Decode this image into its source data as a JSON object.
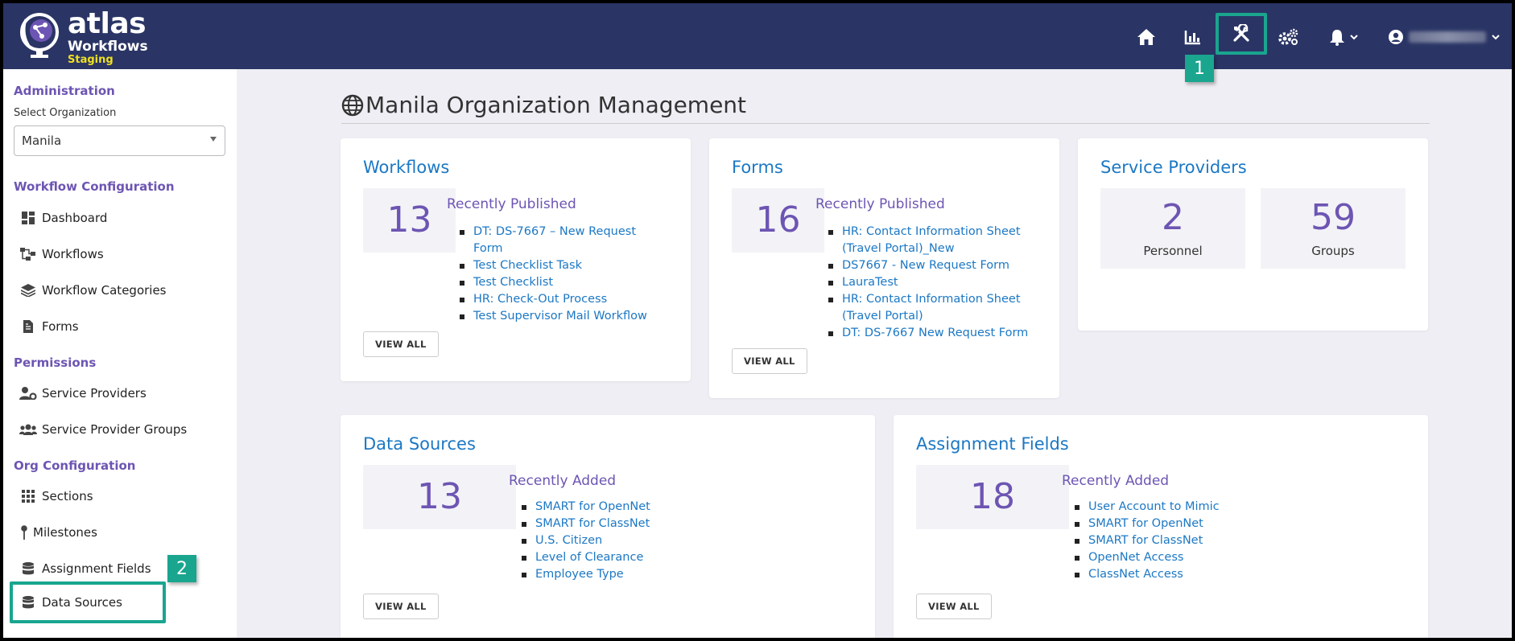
{
  "brand": {
    "name": "atlas",
    "product": "Workflows",
    "environment": "Staging"
  },
  "topnav": {
    "icons": [
      "home-icon",
      "bar-chart-icon",
      "tools-icon",
      "gears-icon",
      "bell-icon",
      "user-circle-icon"
    ],
    "callout_1": "1"
  },
  "sidebar": {
    "admin_heading": "Administration",
    "select_org_label": "Select Organization",
    "select_org_value": "Manila",
    "workflow_config_heading": "Workflow Configuration",
    "workflow_items": [
      "Dashboard",
      "Workflows",
      "Workflow Categories",
      "Forms"
    ],
    "permissions_heading": "Permissions",
    "permission_items": [
      "Service Providers",
      "Service Provider Groups"
    ],
    "org_config_heading": "Org Configuration",
    "org_items": [
      "Sections",
      "Milestones",
      "Assignment Fields",
      "Data Sources"
    ],
    "callout_2": "2"
  },
  "main": {
    "title": "Manila Organization Management",
    "workflows": {
      "title": "Workflows",
      "count": "13",
      "recent_heading": "Recently Published",
      "items": [
        "DT: DS-7667 – New Request Form",
        "Test Checklist Task",
        "Test Checklist",
        "HR: Check-Out Process",
        "Test Supervisor Mail Workflow"
      ],
      "view_all": "VIEW ALL"
    },
    "forms": {
      "title": "Forms",
      "count": "16",
      "recent_heading": "Recently Published",
      "items": [
        "HR: Contact Information Sheet (Travel Portal)_New",
        "DS7667 - New Request Form",
        "LauraTest",
        "HR: Contact Information Sheet (Travel Portal)",
        "DT: DS-7667 New Request Form"
      ],
      "view_all": "VIEW ALL"
    },
    "service_providers": {
      "title": "Service Providers",
      "personnel_count": "2",
      "personnel_label": "Personnel",
      "groups_count": "59",
      "groups_label": "Groups"
    },
    "data_sources": {
      "title": "Data Sources",
      "count": "13",
      "recent_heading": "Recently Added",
      "items": [
        "SMART for OpenNet",
        "SMART for ClassNet",
        "U.S. Citizen",
        "Level of Clearance",
        "Employee Type"
      ],
      "view_all": "VIEW ALL"
    },
    "assignment_fields": {
      "title": "Assignment Fields",
      "count": "18",
      "recent_heading": "Recently Added",
      "items": [
        "User Account to Mimic",
        "SMART for OpenNet",
        "SMART for ClassNet",
        "OpenNet Access",
        "ClassNet Access"
      ],
      "view_all": "VIEW ALL"
    }
  },
  "colors": {
    "topbar": "#2a3565",
    "accent_purple": "#6d55b3",
    "link_blue": "#1c78c4",
    "highlight_teal": "#1aa58f",
    "staging_yellow": "#f0e020"
  }
}
